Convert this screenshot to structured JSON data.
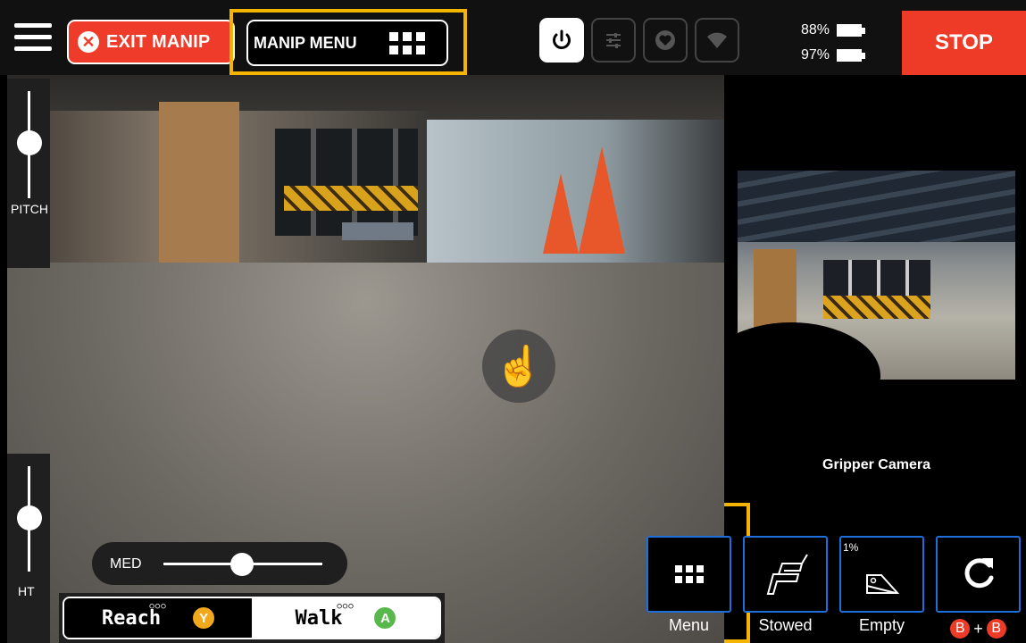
{
  "topbar": {
    "exit_label": "EXIT MANIP",
    "manip_menu_label": "MANIP MENU",
    "stop_label": "STOP",
    "batteries": [
      {
        "percent": "88%"
      },
      {
        "percent": "97%"
      }
    ]
  },
  "left": {
    "pitch_label": "PITCH",
    "ht_label": "HT",
    "speed_label": "MED",
    "mode_reach": "Reach",
    "mode_walk": "Walk",
    "badge_reach": "Y",
    "badge_walk": "A",
    "mode_dots": "○○○"
  },
  "gripper": {
    "label": "Gripper Camera"
  },
  "actions": {
    "menu_label": "Menu",
    "stowed_label": "Stowed",
    "empty_label": "Empty",
    "empty_value": "1%",
    "b_badge": "B",
    "b_plus": "+"
  },
  "colors": {
    "accent": "#f4b400",
    "stop": "#ee3b27",
    "action_border": "#1e6fd9"
  },
  "icons": [
    "menu-icon",
    "close-circle-icon",
    "grid-icon",
    "power-icon",
    "sliders-icon",
    "heart-icon",
    "wifi-icon",
    "battery-icon",
    "hand-pointer-icon",
    "arm-stowed-icon",
    "gripper-icon",
    "refresh-icon"
  ]
}
